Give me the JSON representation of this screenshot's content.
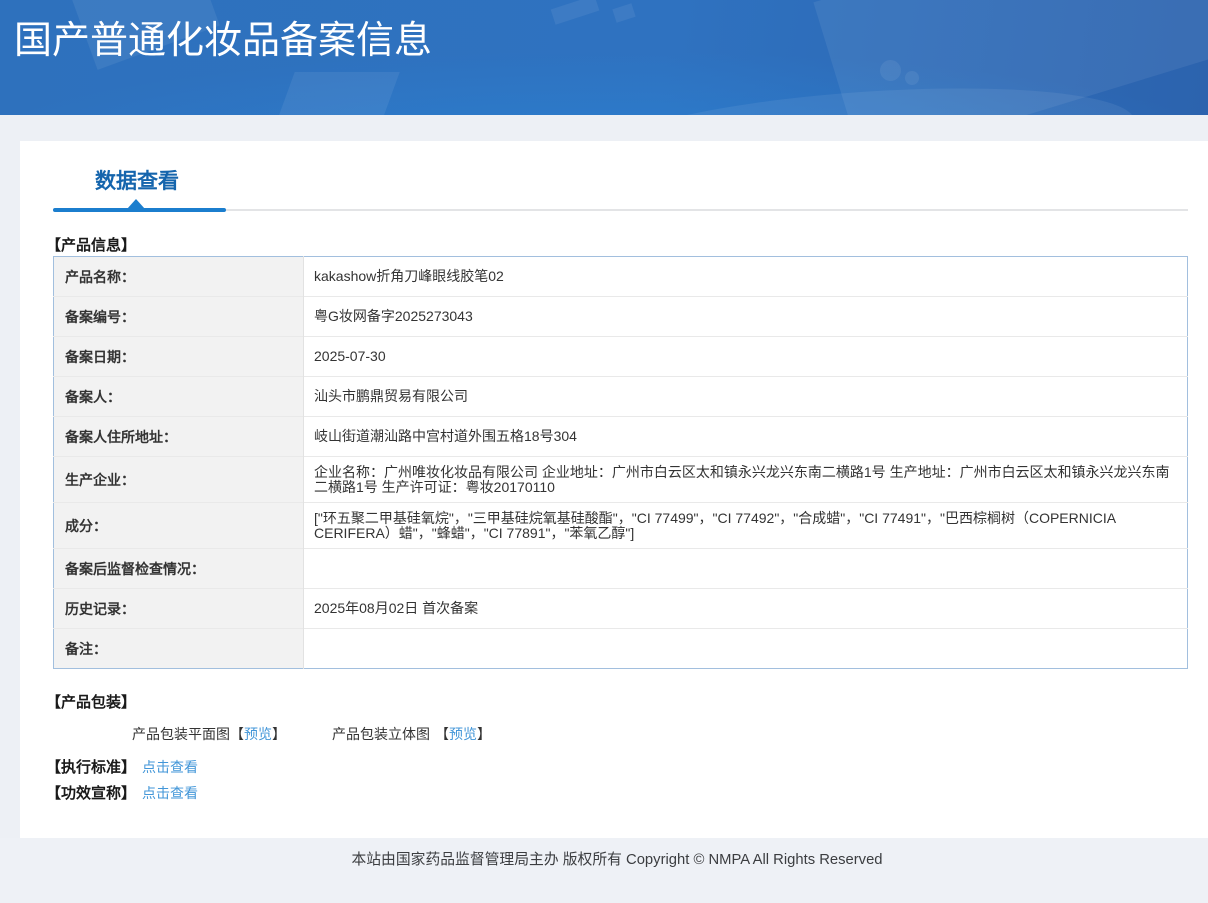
{
  "banner": {
    "title": "国产普通化妆品备案信息"
  },
  "tabs": {
    "active": "数据查看"
  },
  "sections": {
    "product_info_heading": "【产品信息】",
    "packaging_heading": "【产品包装】",
    "standard_heading": "【执行标准】",
    "efficacy_heading": "【功效宣称】",
    "view_link_label": "点击查看"
  },
  "packaging": {
    "flat_label": "产品包装平面图",
    "flat_bracket_open": "【",
    "flat_preview": "预览",
    "flat_bracket_close": "】",
    "stereo_label": "产品包装立体图",
    "stereo_bracket_open": "【",
    "stereo_preview": "预览",
    "stereo_bracket_close": "】"
  },
  "table": {
    "rows": [
      {
        "label": "产品名称：",
        "value": "kakashow折角刀峰眼线胶笔02"
      },
      {
        "label": "备案编号：",
        "value": "粤G妆网备字2025273043"
      },
      {
        "label": "备案日期：",
        "value": "2025-07-30"
      },
      {
        "label": "备案人：",
        "value": "汕头市鹏鼎贸易有限公司"
      },
      {
        "label": "备案人住所地址：",
        "value": "岐山街道潮汕路中宫村道外围五格18号304"
      },
      {
        "label": "生产企业：",
        "value": "企业名称：广州唯妆化妆品有限公司 企业地址：广州市白云区太和镇永兴龙兴东南二横路1号 生产地址：广州市白云区太和镇永兴龙兴东南二横路1号 生产许可证：粤妆20170110"
      },
      {
        "label": "成分：",
        "value": "[\"环五聚二甲基硅氧烷\"，\"三甲基硅烷氧基硅酸酯\"，\"CI 77499\"，\"CI 77492\"，\"合成蜡\"，\"CI 77491\"，\"巴西棕榈树（COPERNICIA CERIFERA）蜡\"，\"蜂蜡\"，\"CI 77891\"，\"苯氧乙醇\"]"
      },
      {
        "label": "备案后监督检查情况：",
        "value": ""
      },
      {
        "label": "历史记录：",
        "value": "2025年08月02日 首次备案"
      },
      {
        "label": "备注：",
        "value": ""
      }
    ]
  },
  "footer": {
    "text": "本站由国家药品监督管理局主办 版权所有 Copyright © NMPA All Rights Reserved"
  },
  "colors": {
    "banner_blue_left": "#2e72bf",
    "banner_blue_right": "#2c64b0",
    "banner_glow": "#2b84d6",
    "tab_text": "#1565ad",
    "accent_bar": "#1b7ece",
    "link_blue": "#4296d8",
    "table_border": "#a2bfde",
    "label_bg": "#f2f2f2",
    "page_bg": "#edf0f5",
    "footer_bg": "#eef1f6"
  }
}
